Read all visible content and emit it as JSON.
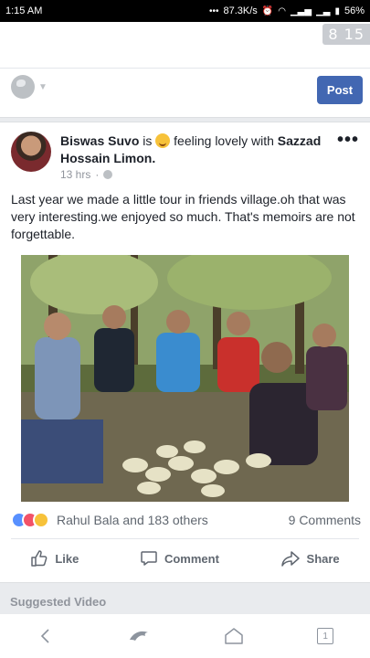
{
  "status_bar": {
    "time": "1:15 AM",
    "network_speed": "87.3K/s",
    "battery": "56%"
  },
  "composer": {
    "counter": "8 15",
    "post_label": "Post"
  },
  "post": {
    "author": "Biswas Suvo",
    "connector_is": "is",
    "feeling_text": "feeling lovely with",
    "tagged": "Sazzad Hossain Limon.",
    "time_ago": "13 hrs",
    "more_label": "•••",
    "body": "Last year we made a little tour in friends village.oh that was very interesting.we enjoyed so much. That's memoirs are not forgettable.",
    "reactions_text": "Rahul Bala and 183 others",
    "comments_count": "9 Comments",
    "actions": {
      "like": "Like",
      "comment": "Comment",
      "share": "Share"
    }
  },
  "suggested_label": "Suggested Video",
  "nav": {
    "tab_count": "1"
  },
  "colors": {
    "brand": "#4267b2",
    "like": "#5890ff",
    "love": "#f25268",
    "wow": "#f7c23a"
  }
}
